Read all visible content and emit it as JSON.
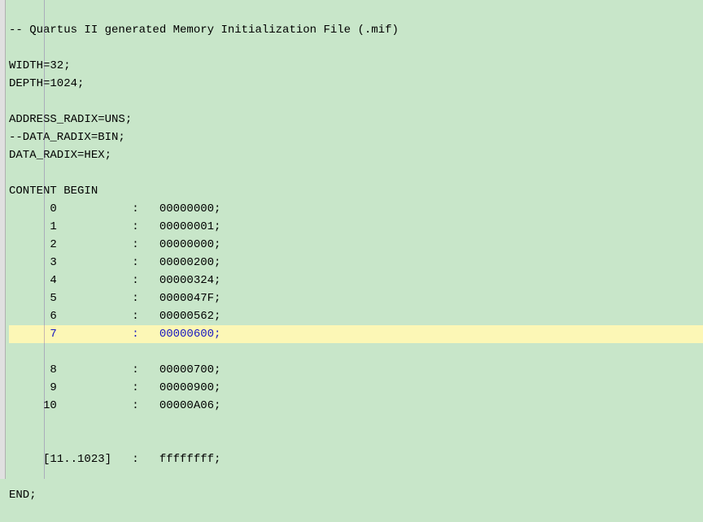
{
  "header_comment": "-- Quartus II generated Memory Initialization File (.mif)",
  "width_line": "WIDTH=32;",
  "depth_line": "DEPTH=1024;",
  "addr_radix_line": "ADDRESS_RADIX=UNS;",
  "data_radix_comment": "--DATA_RADIX=BIN;",
  "data_radix_line": "DATA_RADIX=HEX;",
  "content_begin": "CONTENT BEGIN",
  "rows": [
    {
      "addr": "0",
      "value": "00000000"
    },
    {
      "addr": "1",
      "value": "00000001"
    },
    {
      "addr": "2",
      "value": "00000000"
    },
    {
      "addr": "3",
      "value": "00000200"
    },
    {
      "addr": "4",
      "value": "00000324"
    },
    {
      "addr": "5",
      "value": "0000047F"
    },
    {
      "addr": "6",
      "value": "00000562"
    },
    {
      "addr": "7",
      "value": "00000600"
    },
    {
      "addr": "8",
      "value": "00000700"
    },
    {
      "addr": "9",
      "value": "00000900"
    },
    {
      "addr": "10",
      "value": "00000A06"
    }
  ],
  "highlighted_index": 7,
  "range_row": {
    "addr": "[11..1023]",
    "value": "ffffffff"
  },
  "end_line": "END;"
}
